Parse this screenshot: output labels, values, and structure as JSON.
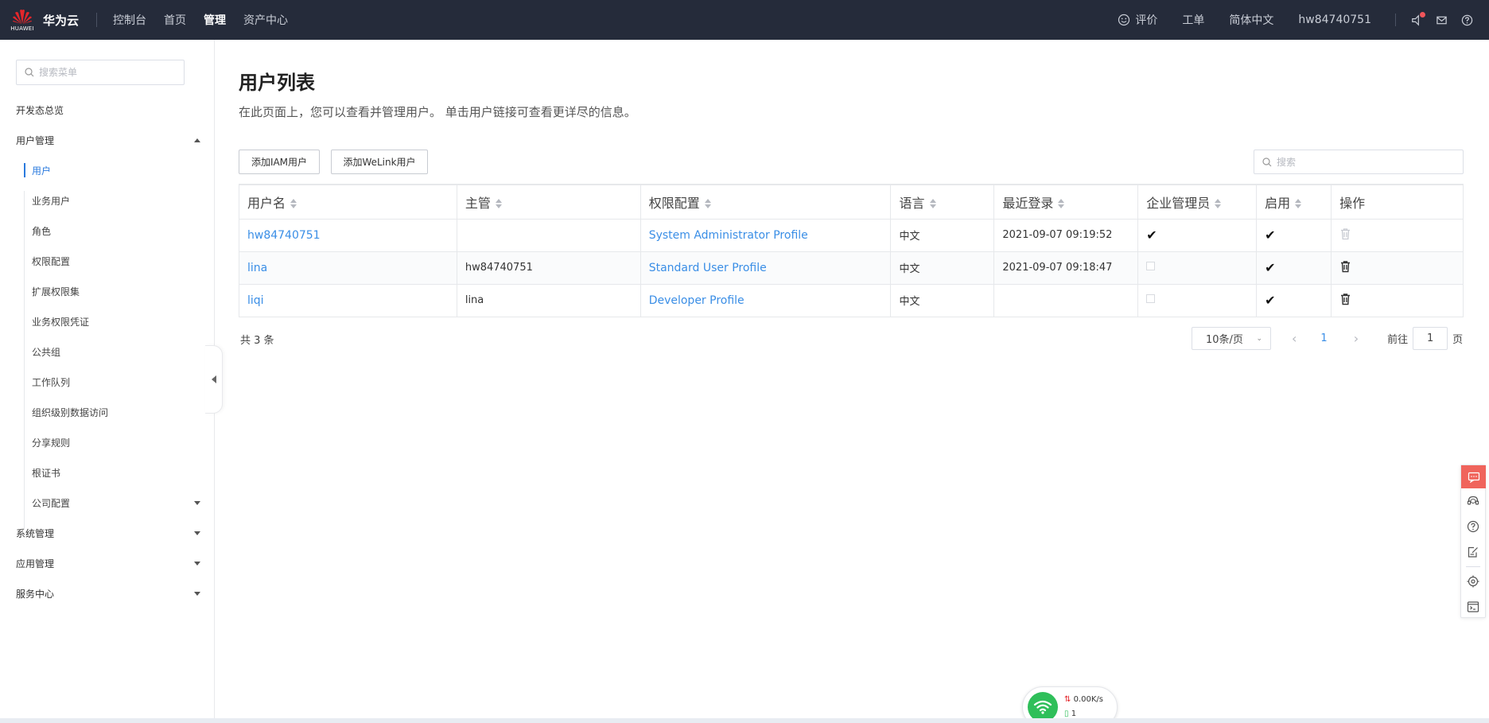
{
  "topbar": {
    "logo_word": "HUAWEI",
    "brand": "华为云",
    "nav": [
      {
        "label": "控制台",
        "active": false
      },
      {
        "label": "首页",
        "active": false
      },
      {
        "label": "管理",
        "active": true
      },
      {
        "label": "资产中心",
        "active": false
      }
    ],
    "right": {
      "rating": "评价",
      "ticket": "工单",
      "language": "简体中文",
      "username": "hw84740751"
    },
    "icons": [
      "smile-icon",
      "notification-icon",
      "mail-icon",
      "help-icon"
    ]
  },
  "sidebar": {
    "search_placeholder": "搜索菜单",
    "items": [
      {
        "label": "开发态总览"
      },
      {
        "label": "用户管理"
      },
      {
        "label": "用户"
      },
      {
        "label": "业务用户"
      },
      {
        "label": "角色"
      },
      {
        "label": "权限配置"
      },
      {
        "label": "扩展权限集"
      },
      {
        "label": "业务权限凭证"
      },
      {
        "label": "公共组"
      },
      {
        "label": "工作队列"
      },
      {
        "label": "组织级别数据访问"
      },
      {
        "label": "分享规则"
      },
      {
        "label": "根证书"
      },
      {
        "label": "公司配置"
      },
      {
        "label": "系统管理"
      },
      {
        "label": "应用管理"
      },
      {
        "label": "服务中心"
      }
    ]
  },
  "main": {
    "title": "用户列表",
    "description": "在此页面上，您可以查看并管理用户。 单击用户链接可查看更详尽的信息。",
    "add_iam_button": "添加IAM用户",
    "add_welink_button": "添加WeLink用户",
    "search_placeholder": "搜索",
    "table": {
      "columns": [
        "用户名",
        "主管",
        "权限配置",
        "语言",
        "最近登录",
        "企业管理员",
        "启用",
        "操作"
      ],
      "rows": [
        {
          "username": "hw84740751",
          "manager": "",
          "profile": "System Administrator Profile",
          "language": "中文",
          "last_login": "2021-09-07 09:19:52",
          "admin": "✔",
          "enabled": "✔"
        },
        {
          "username": "lina",
          "manager": "hw84740751",
          "profile": "Standard User Profile",
          "language": "中文",
          "last_login": "2021-09-07 09:18:47",
          "admin": "",
          "enabled": "✔"
        },
        {
          "username": "liqi",
          "manager": "lina",
          "profile": "Developer Profile",
          "language": "中文",
          "last_login": "",
          "admin": "",
          "enabled": "✔"
        }
      ]
    },
    "total": "共 3 条",
    "pager": {
      "page_size": "10条/页",
      "current_page": "1",
      "goto_label": "前往",
      "goto_value": "1",
      "page_unit": "页"
    }
  },
  "net_widget": {
    "speed": "0.00K/s",
    "count": "1"
  },
  "colors": {
    "topbar_bg": "#252b3a",
    "link": "#3a8ee6",
    "accent": "#2a7ade",
    "float_red": "#f0645c",
    "net_green": "#2fbf5a"
  }
}
